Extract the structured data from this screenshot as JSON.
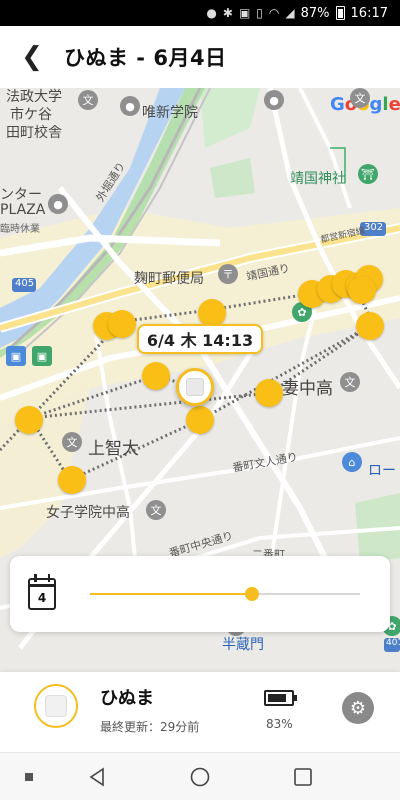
{
  "status_bar": {
    "battery": "87%",
    "time": "16:17"
  },
  "app_bar": {
    "back_glyph": "❮",
    "title": "ひぬま - 6月4日"
  },
  "map": {
    "google": [
      "G",
      "o",
      "o",
      "g",
      "l",
      "e"
    ],
    "labels": {
      "school1a": "法政大学",
      "school1b": "市ケ谷",
      "school1c": "田町校舎",
      "yuishin": "唯新学院",
      "center": "ンター",
      "plaza": "PLAZA",
      "closed": "臨時休業",
      "sotobori": "外堀通り",
      "yasukuni": "靖国神社",
      "kojimachi_post": "麹町郵便局",
      "yasukuni_st": "靖国通り",
      "shuto_route": "都営新宿線",
      "route_302": "302",
      "route_405": "405",
      "jochi": "上智大",
      "tsuma": "妻中高",
      "joshi": "女子学院中高",
      "bancho_bun": "番町文人通り",
      "bancho_chuo": "番町中央通り",
      "bancho": "二番町",
      "hanzomon": "半蔵門",
      "lawson": "ロー",
      "kitanomaru": "北",
      "route_401": "401"
    },
    "tooltip": "6/4 木 14:13"
  },
  "timeline": {
    "calendar_day": "4",
    "slider_progress": 0.6
  },
  "device": {
    "name": "ひぬま",
    "last_update": "最終更新：29分前",
    "battery_percent": "83%",
    "battery_level": 0.83
  },
  "colors": {
    "accent": "#f5bd1f",
    "point": "#f9bf16"
  }
}
